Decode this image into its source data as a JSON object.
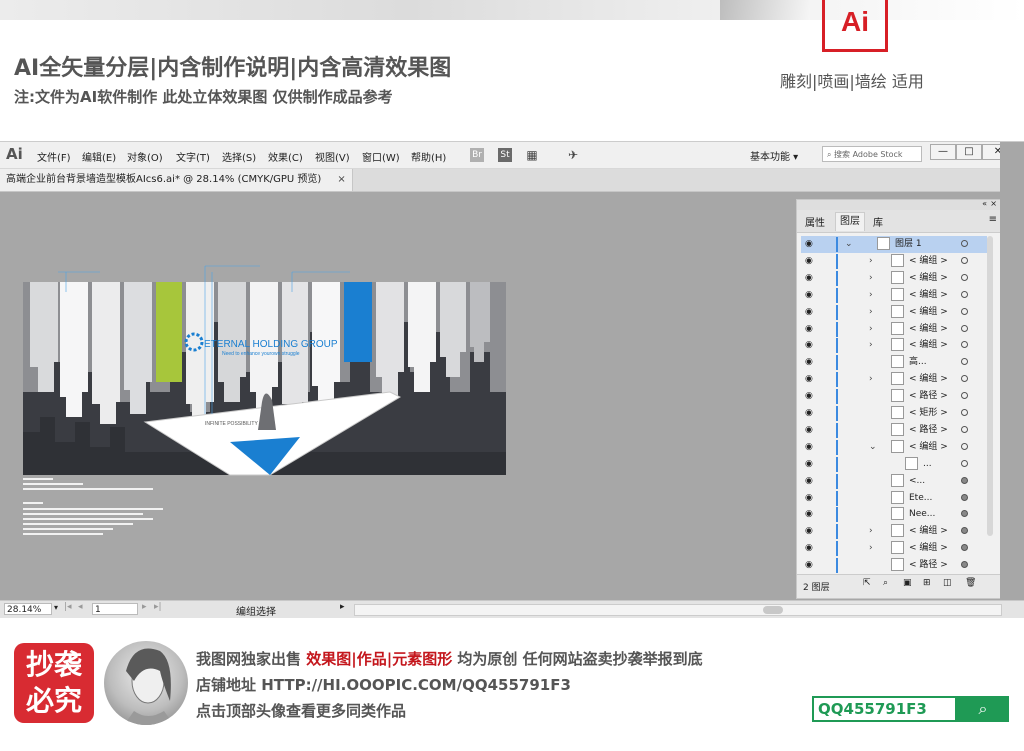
{
  "promo": {
    "title": "AI全矢量分层|内含制作说明|内含高清效果图",
    "note": "注:文件为AI软件制作 此处立体效果图 仅供制作成品参考",
    "logo_text": "Ai",
    "caption": "雕刻|喷画|墙绘 适用"
  },
  "app": {
    "logo": "Ai",
    "menus": [
      "文件(F)",
      "编辑(E)",
      "对象(O)",
      "文字(T)",
      "选择(S)",
      "效果(C)",
      "视图(V)",
      "窗口(W)",
      "帮助(H)"
    ],
    "toolbar_icons": [
      {
        "name": "bridge-icon",
        "label": "Br",
        "color": "#b0b0b0"
      },
      {
        "name": "stock-icon",
        "label": "St",
        "color": "#6a6a6a"
      }
    ],
    "workspace": "基本功能",
    "stock_search_placeholder": "搜索 Adobe Stock",
    "window_buttons": [
      "—",
      "□",
      "✕"
    ]
  },
  "document_tab": {
    "title": "高端企业前台背景墙造型模板AIcs6.ai* @ 28.14% (CMYK/GPU 预览)",
    "close": "×"
  },
  "artwork": {
    "brand_line1": "ETERNAL HOLDING GROUP",
    "brand_line2": "Need to enhance yourown struggle",
    "tagline": "INFINITE POSSIBILITY",
    "accent_green": "#a7c63b",
    "accent_blue": "#1a7fd1",
    "dark": "#3a3c42"
  },
  "layers_panel": {
    "tabs": [
      "属性",
      "图层",
      "库"
    ],
    "active_tab": "图层",
    "layers": [
      {
        "name": "图层 1",
        "indent": 0,
        "expanded": true,
        "selected": true,
        "target_filled": false
      },
      {
        "name": "< 编组 >",
        "indent": 1,
        "expandable": true,
        "target_filled": false
      },
      {
        "name": "< 编组 >",
        "indent": 1,
        "expandable": true,
        "target_filled": false
      },
      {
        "name": "< 编组 >",
        "indent": 1,
        "expandable": true,
        "target_filled": false
      },
      {
        "name": "< 编组 >",
        "indent": 1,
        "expandable": true,
        "target_filled": false
      },
      {
        "name": "< 编组 >",
        "indent": 1,
        "expandable": true,
        "target_filled": false
      },
      {
        "name": "< 编组 >",
        "indent": 1,
        "expandable": true,
        "target_filled": false
      },
      {
        "name": "高...",
        "indent": 1,
        "expandable": false,
        "target_filled": false
      },
      {
        "name": "< 编组 >",
        "indent": 1,
        "expandable": true,
        "target_filled": false
      },
      {
        "name": "< 路径 >",
        "indent": 1,
        "expandable": false,
        "target_filled": false
      },
      {
        "name": "< 矩形 >",
        "indent": 1,
        "expandable": false,
        "target_filled": false
      },
      {
        "name": "< 路径 >",
        "indent": 1,
        "expandable": false,
        "target_filled": false
      },
      {
        "name": "< 编组 >",
        "indent": 1,
        "expandable": true,
        "expanded": true,
        "target_filled": false
      },
      {
        "name": "...",
        "indent": 2,
        "expandable": false,
        "target_filled": false
      },
      {
        "name": "<...",
        "indent": 1,
        "expandable": false,
        "target_filled": true
      },
      {
        "name": "Ete...",
        "indent": 1,
        "expandable": false,
        "target_filled": true
      },
      {
        "name": "Nee...",
        "indent": 1,
        "expandable": false,
        "target_filled": true
      },
      {
        "name": "< 编组 >",
        "indent": 1,
        "expandable": true,
        "target_filled": true
      },
      {
        "name": "< 编组 >",
        "indent": 1,
        "expandable": true,
        "target_filled": true
      },
      {
        "name": "< 路径 >",
        "indent": 1,
        "expandable": false,
        "target_filled": true
      }
    ],
    "layer_count": "2 图层"
  },
  "statusbar": {
    "zoom": "28.14%",
    "page": "1",
    "status": "编组选择"
  },
  "footer": {
    "stamp_line1": "抄袭",
    "stamp_line2": "必究",
    "line1_prefix": "我图网独家出售 ",
    "line1_red": "效果图|作品|元素图形",
    "line1_suffix": " 均为原创 任何网站盗卖抄袭举报到底",
    "line2": "店铺地址 HTTP://HI.OOOPIC.COM/QQ455791F3",
    "line3": "点击顶部头像查看更多同类作品",
    "search_value": "QQ455791F3"
  }
}
